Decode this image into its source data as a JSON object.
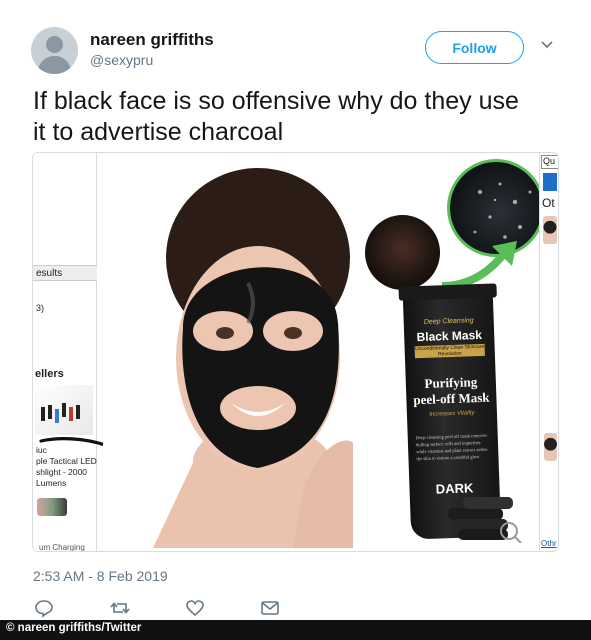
{
  "author": {
    "name": "nareen griffiths",
    "handle": "@sexypru"
  },
  "follow_button": {
    "label": "Follow"
  },
  "tweet": {
    "text_line1": "If black face is so offensive why do they use",
    "text_line2": "it to advertise charcoal",
    "timestamp": "2:53 AM - 8 Feb 2019"
  },
  "media": {
    "left_strip": {
      "results": "esults",
      "count": "3)",
      "sellers": "ellers",
      "product_line1": "ple Tactical LED",
      "product_line2": "shlight - 2000",
      "product_line3": "Lumens",
      "product_line0": "iuc",
      "bottom": "um Charging"
    },
    "product": {
      "tagline": "Deep Cleansing",
      "name": "Black Mask",
      "badge": "Unconditionally Clean Skincare Revolution",
      "title_line1": "Purifying",
      "title_line2": "peel-off Mask",
      "subtitle": "Increases Vitality",
      "description": "Deep cleansing peel off mask removes dulling surface cells and impurities while vitamins and plant extract soften the skin to restore a youthful glow",
      "variant": "DARK"
    },
    "right_strip": {
      "qu": "Qu",
      "ot": "Ot",
      "othr": "Othr"
    }
  },
  "actions": {
    "icons": [
      "reply-icon",
      "retweet-icon",
      "like-icon",
      "message-icon"
    ]
  },
  "credit": "© nareen griffiths/Twitter",
  "colors": {
    "accent": "#1da1f2",
    "secondary_text": "#657786",
    "arrow_green": "#5bbd5a"
  }
}
